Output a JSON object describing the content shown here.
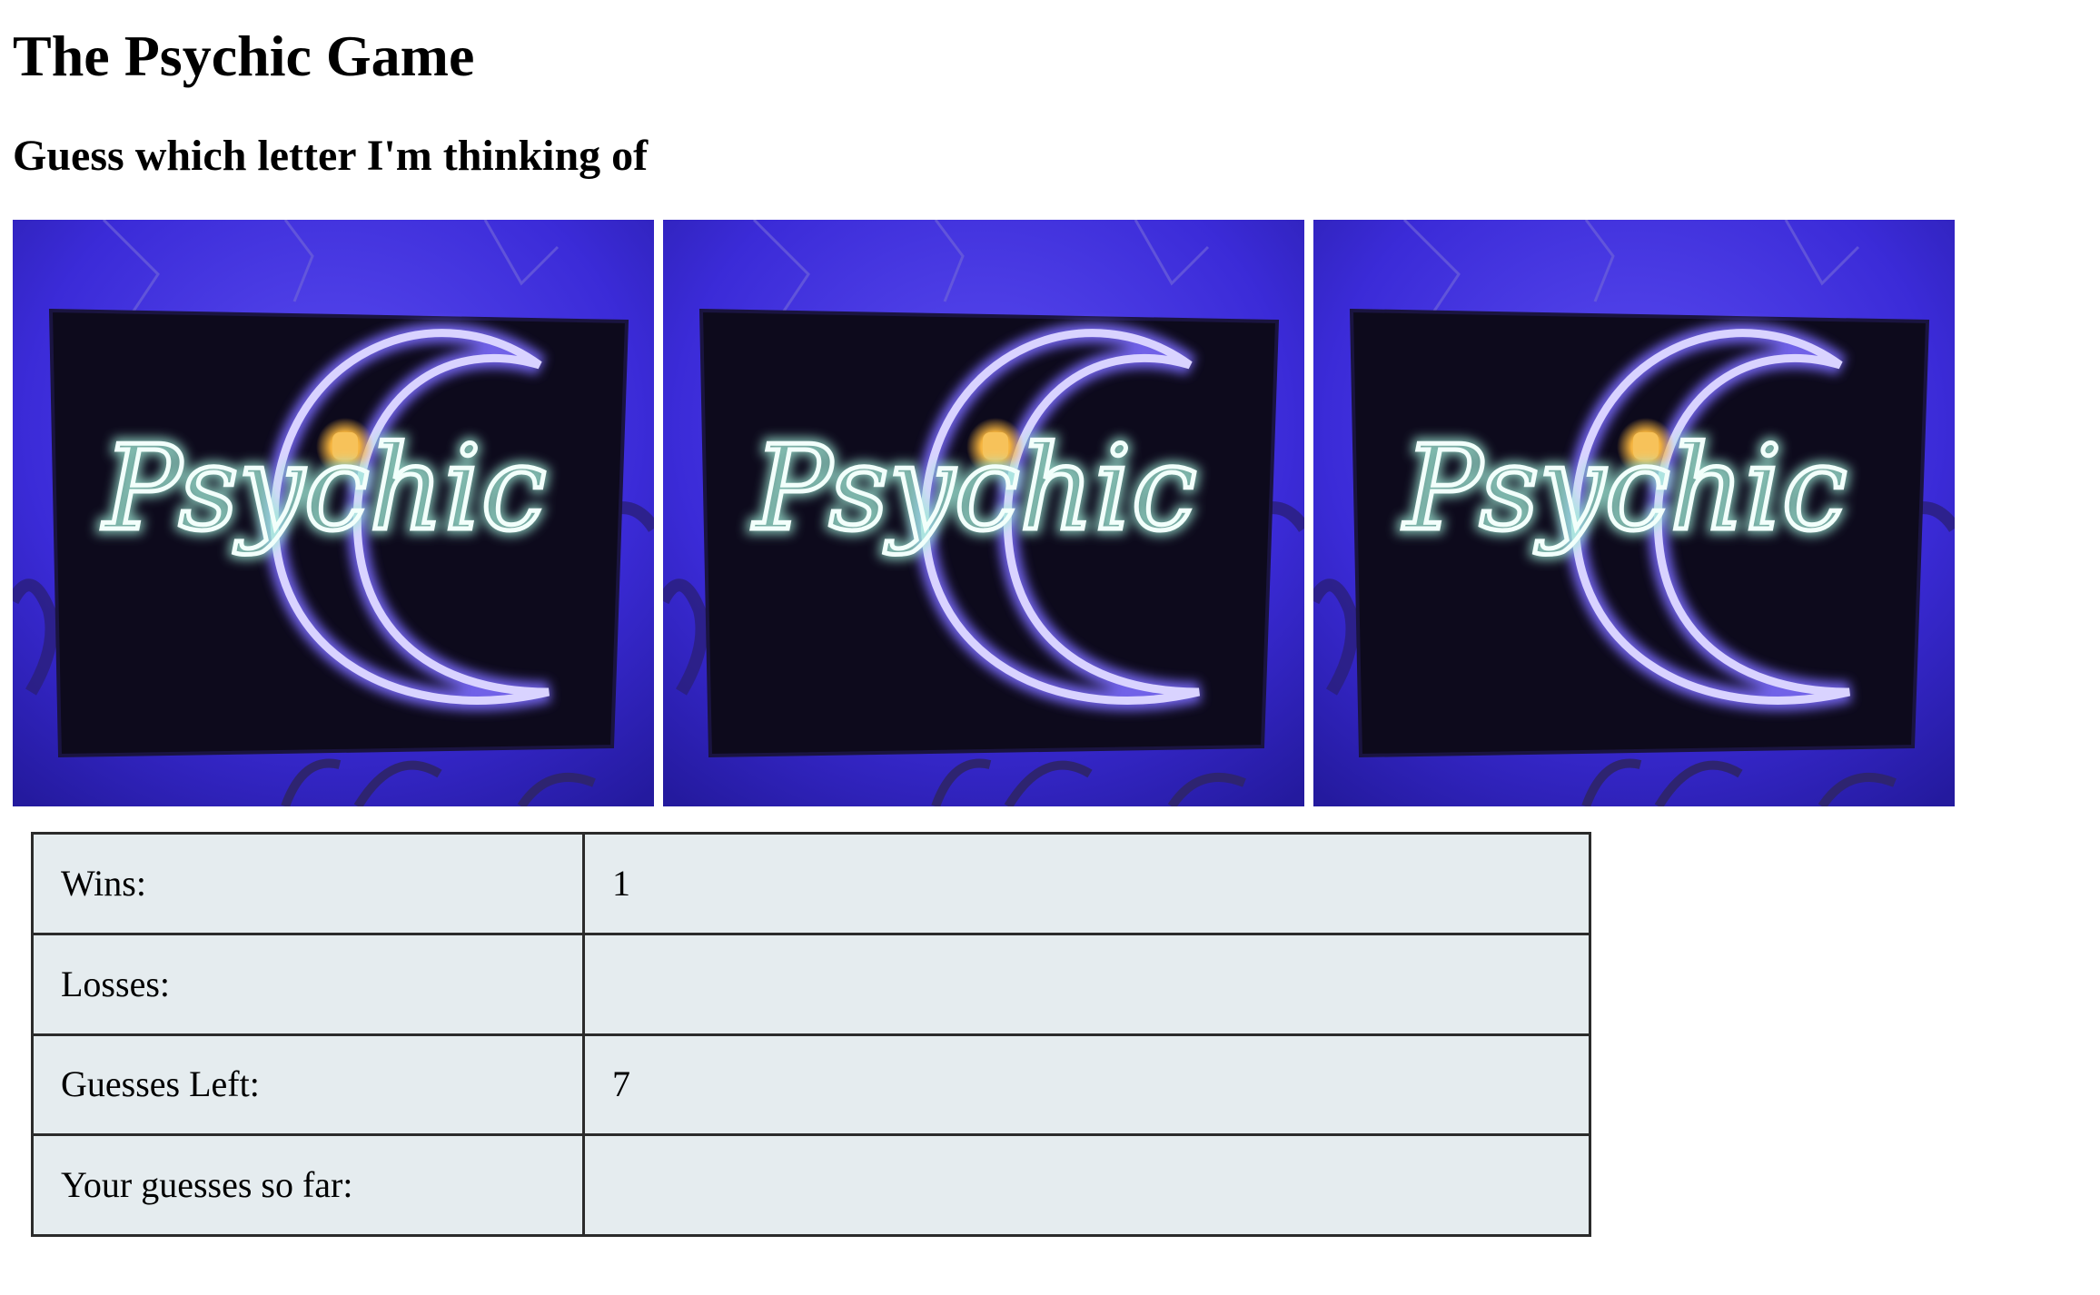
{
  "page": {
    "title": "The Psychic Game",
    "subtitle": "Guess which letter I'm thinking of"
  },
  "images": {
    "count": 3,
    "alt": "Psychic",
    "sign_text": "Psychic",
    "colors": {
      "background": "#3b2bd8",
      "board": "#0d0a1c",
      "neon_moon": "#a89cff",
      "neon_text": "#e8fff6",
      "lamp": "#f4b23c"
    }
  },
  "stats": {
    "rows": [
      {
        "label": "Wins:",
        "value": "1"
      },
      {
        "label": "Losses:",
        "value": ""
      },
      {
        "label": "Guesses Left:",
        "value": "7"
      },
      {
        "label": "Your guesses so far:",
        "value": ""
      }
    ],
    "colors": {
      "cell_background": "#e5ecef",
      "border": "#2b2b2b"
    }
  }
}
